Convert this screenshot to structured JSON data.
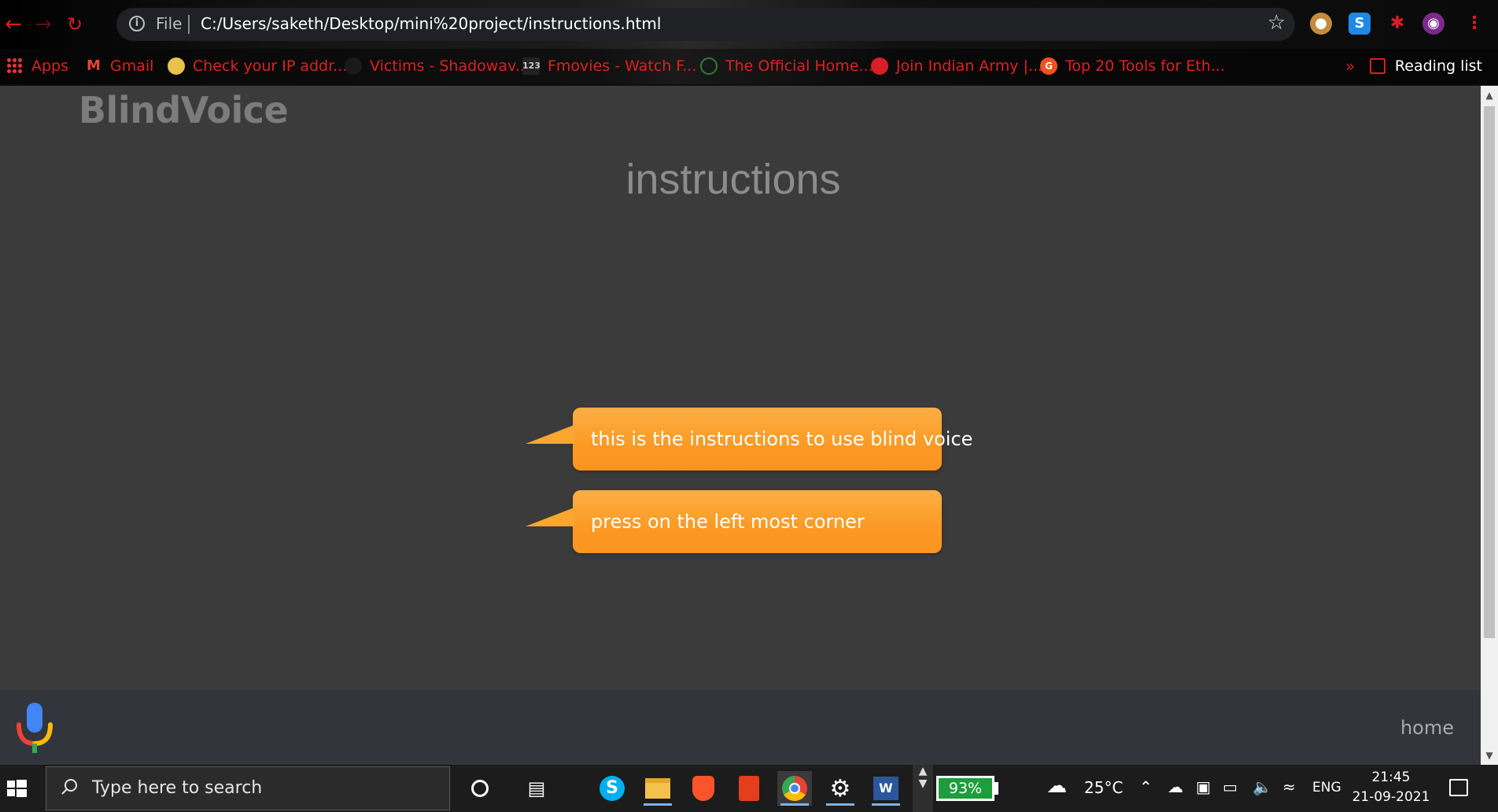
{
  "browser": {
    "address_prefix": "File",
    "url": "C:/Users/saketh/Desktop/mini%20project/instructions.html",
    "bookmarks": [
      {
        "label": "Apps",
        "icon": "apps-grid-icon"
      },
      {
        "label": "Gmail",
        "icon": "gmail-icon"
      },
      {
        "label": "Check your IP addr...",
        "icon": "ip-check-icon"
      },
      {
        "label": "Victims - Shadowav...",
        "icon": "shadow-icon"
      },
      {
        "label": "Fmovies - Watch F...",
        "icon": "fmovies-icon"
      },
      {
        "label": "The Official Home...",
        "icon": "official-home-icon"
      },
      {
        "label": "Join Indian Army |...",
        "icon": "indian-army-icon"
      },
      {
        "label": "Top 20 Tools for Eth...",
        "icon": "tools-icon"
      }
    ],
    "bookmarks_overflow": "»",
    "reading_list": "Reading list",
    "extension_labels": {
      "skype": "S",
      "windows": "W"
    }
  },
  "page": {
    "brand": "BlindVoice",
    "title": "instructions",
    "messages": [
      "this is the instructions to use blind voice",
      "press on the left most corner"
    ],
    "footer_link": "home"
  },
  "taskbar": {
    "search_placeholder": "Type here to search",
    "battery": "93%",
    "temperature": "25°C",
    "language": "ENG",
    "time": "21:45",
    "date": "21-09-2021"
  },
  "colors": {
    "page_bg": "#3b3b3b",
    "bubble": "#fba62f",
    "footer_bg": "#32353b",
    "accent_red": "#d81f26"
  }
}
